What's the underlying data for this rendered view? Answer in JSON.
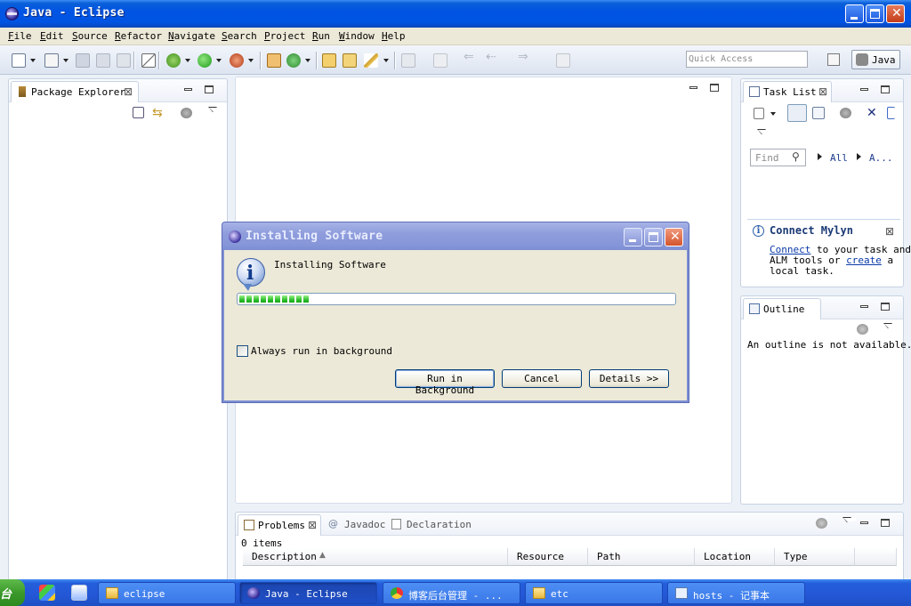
{
  "window": {
    "title": "Java - Eclipse"
  },
  "menu": [
    "File",
    "Edit",
    "Source",
    "Refactor",
    "Navigate",
    "Search",
    "Project",
    "Run",
    "Window",
    "Help"
  ],
  "toolbar": {
    "quick_access_placeholder": "Quick Access",
    "perspective_label": "Java"
  },
  "package_explorer": {
    "tab_label": "Package Explorer"
  },
  "task_list": {
    "tab_label": "Task List",
    "find_placeholder": "Find",
    "filter_all": "All",
    "filter_activate": "A...",
    "connect_title": "Connect Mylyn",
    "connect_link": "Connect",
    "connect_text_1": " to your task and",
    "connect_text_2": "ALM tools or ",
    "create_link": "create",
    "connect_text_3": " a",
    "connect_text_4": "local task."
  },
  "outline": {
    "tab_label": "Outline",
    "empty_message": "An outline is not available."
  },
  "bottom_panel": {
    "tabs": [
      "Problems",
      "Javadoc",
      "Declaration"
    ],
    "items_count": "0 items",
    "columns": [
      "Description",
      "Resource",
      "Path",
      "Location",
      "Type"
    ]
  },
  "dialog": {
    "title": "Installing Software",
    "message": "Installing Software",
    "progress": 0.17,
    "checkbox_label": "Always run in background",
    "checkbox_checked": false,
    "buttons": {
      "background": "Run in Background",
      "cancel": "Cancel",
      "details": "Details >>"
    }
  },
  "taskbar": {
    "start_label": "台",
    "tasks": [
      {
        "label": "eclipse",
        "icon": "folder-icon"
      },
      {
        "label": "Java - Eclipse",
        "icon": "eclipse-icon"
      },
      {
        "label": "博客后台管理 - ...",
        "icon": "chrome-icon"
      },
      {
        "label": "etc",
        "icon": "folder-icon"
      },
      {
        "label": "hosts - 记事本",
        "icon": "notepad-icon"
      }
    ]
  },
  "colors": {
    "xp_title": "#0054e3",
    "dialog_title_inactive": "#8f9ddc",
    "progress_green": "#2fbf2f"
  }
}
